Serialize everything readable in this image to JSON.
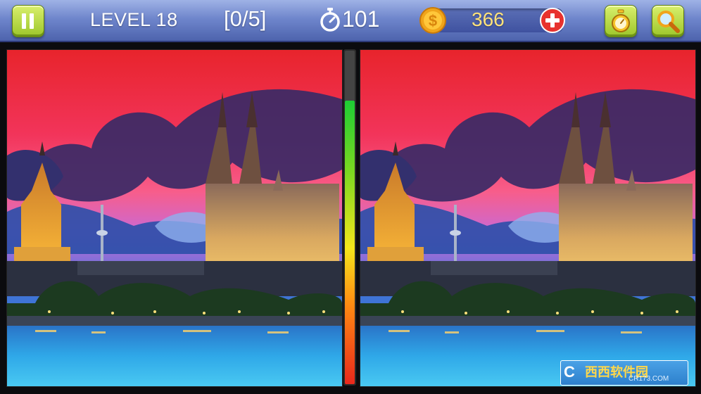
{
  "topbar": {
    "pause_icon": "pause-icon",
    "level_label": "LEVEL 18",
    "found_counter": "[0/5]",
    "timer_icon": "stopwatch-icon",
    "timer_value": "101",
    "coin_icon": "dollar-coin-icon",
    "coins": "366",
    "add_coins_icon": "plus-icon",
    "hint_icon": "stopwatch-icon",
    "zoom_icon": "magnifier-icon"
  },
  "progress_meter": {
    "fill_fraction": 0.85
  },
  "watermark": {
    "logo": "C",
    "text": "西西软件园",
    "subtext": "CR173.COM"
  },
  "colors": {
    "topbar": "#6f86cc",
    "button_green": "#b4d83c",
    "coin_text": "#ffe27a",
    "sky_red": "#e8242c",
    "water_blue": "#2fa8e8"
  }
}
